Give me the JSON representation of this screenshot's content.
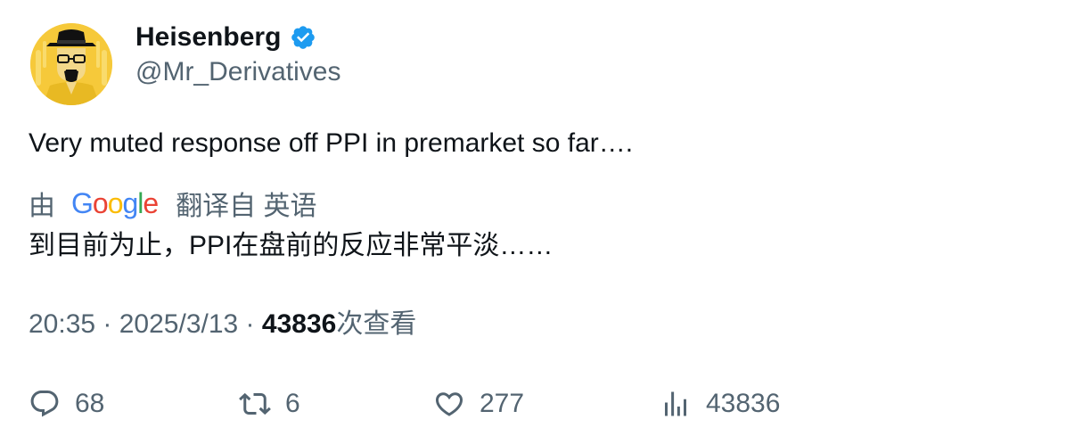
{
  "author": {
    "display_name": "Heisenberg",
    "handle": "@Mr_Derivatives",
    "verified_icon": "verified-badge-icon",
    "avatar_icon": "heisenberg-avatar-icon"
  },
  "tweet": {
    "text": "Very muted response off PPI in premarket so far…."
  },
  "translation": {
    "by_label": "由",
    "provider": "Google",
    "translated_from_label": "翻译自 英语",
    "translated_text": "到目前为止，PPI在盘前的反应非常平淡……"
  },
  "meta": {
    "time": "20:35",
    "separator1": " · ",
    "date": "2025/3/13",
    "separator2": " · ",
    "views_count": "43836",
    "views_label": "次查看"
  },
  "actions": {
    "reply_count": "68",
    "retweet_count": "6",
    "like_count": "277",
    "views_count": "43836"
  },
  "colors": {
    "text_primary": "#0f1419",
    "text_secondary": "#536471",
    "verified_blue": "#1d9bf0",
    "avatar_yellow": "#f6c93a",
    "google_blue": "#4285f4",
    "google_red": "#ea4335",
    "google_yellow": "#fbbc05",
    "google_green": "#34a853"
  }
}
